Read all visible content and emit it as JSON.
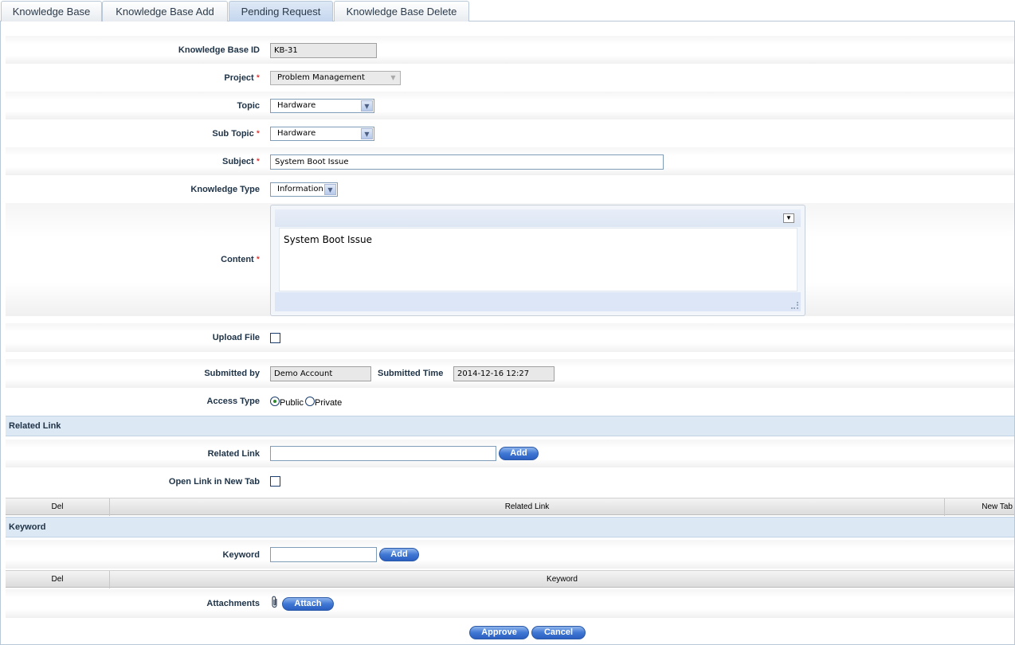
{
  "tabs": [
    {
      "label": "Knowledge Base"
    },
    {
      "label": "Knowledge Base Add"
    },
    {
      "label": "Pending Request"
    },
    {
      "label": "Knowledge Base Delete"
    }
  ],
  "form": {
    "kb_id_label": "Knowledge Base ID",
    "kb_id_value": "KB-31",
    "project_label": "Project",
    "project_value": "Problem Management",
    "topic_label": "Topic",
    "topic_value": "Hardware",
    "subtopic_label": "Sub Topic",
    "subtopic_value": "Hardware",
    "subject_label": "Subject",
    "subject_value": "System Boot Issue",
    "ktype_label": "Knowledge Type",
    "ktype_value": "Information",
    "content_label": "Content",
    "content_value": "System Boot Issue",
    "upload_label": "Upload File",
    "submitted_by_label": "Submitted by",
    "submitted_by_value": "Demo Account",
    "submitted_time_label": "Submitted Time",
    "submitted_time_value": "2014-12-16 12:27",
    "access_label": "Access Type",
    "access_public": "Public",
    "access_private": "Private",
    "required_mark": "*"
  },
  "related": {
    "section_title": "Related Link",
    "link_label": "Related Link",
    "add_label": "Add",
    "new_tab_label": "Open Link in New Tab",
    "columns": [
      "Del",
      "Related Link",
      "New Tab"
    ]
  },
  "keyword": {
    "section_title": "Keyword",
    "label": "Keyword",
    "add_label": "Add",
    "columns": [
      "Del",
      "Keyword"
    ]
  },
  "attachments": {
    "label": "Attachments",
    "attach_label": "Attach"
  },
  "actions": {
    "approve": "Approve",
    "cancel": "Cancel"
  },
  "icons": {
    "select_arrow": "chevron-down-icon",
    "attachment": "paperclip-icon"
  },
  "colors": {
    "button": "#3f77d4",
    "section": "#dde8f5",
    "label": "#203448",
    "required": "#dd0000"
  }
}
